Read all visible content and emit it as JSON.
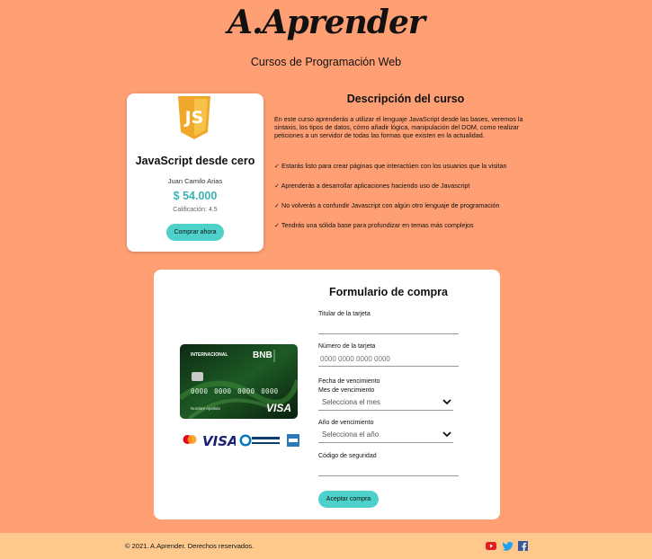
{
  "header": {
    "logo": "A.Aprender",
    "subtitle": "Cursos de Programación Web"
  },
  "course": {
    "badge_icon": "javascript-shield-icon",
    "title": "JavaScript desde cero",
    "author": "Juan Camilo Arias",
    "price": "$ 54.000",
    "rating": "Calificación: 4.5",
    "buy_label": "Comprar ahora"
  },
  "description": {
    "heading": "Descripción del curso",
    "body": "En este curso aprenderás a utilizar el lenguaje JavaScript desde las bases, veremos la sintaxis, los tipos de datos, cómo añadir lógica, manipulación del DOM, como realizar peticiones a un servidor de todas las formas que existen en la actualidad.",
    "points": [
      "✓ Estarás listo para crear páginas que interactúen con los usuarios que la visitan",
      "✓ Aprenderás a desarrollar aplicaciones haciendo uso de Javascript",
      "✓ No volverás a confundir Javascript con algún otro lenguaje de programación",
      "✓ Tendrás una sólida base para profundizar en temas más complejos"
    ]
  },
  "card_image": {
    "label": "INTERNACIONAL",
    "bank": "BNB",
    "number": "0000 0000 0000 0000",
    "holder": "Nombre Apellido",
    "network": "VISA"
  },
  "brands": [
    "mastercard-icon",
    "visa-icon",
    "diners-club-icon",
    "american-express-icon"
  ],
  "form": {
    "heading": "Formulario de compra",
    "holder_label": "Titular de la tarjeta",
    "holder_value": "",
    "number_label": "Número de la tarjeta",
    "number_placeholder": "0000 0000 0000 0000",
    "expiry_label": "Fecha de vencimiento",
    "month_label": "Mes de vencimiento",
    "month_selected": "Selecciona el mes",
    "year_label": "Año de vencimiento",
    "year_selected": "Selecciona el año",
    "cvv_label": "Código de seguridad",
    "cvv_value": "",
    "submit_label": "Aceptar compra"
  },
  "footer": {
    "copyright": "© 2021. A.Aprender. Derechos reservados.",
    "social": [
      "youtube-icon",
      "twitter-icon",
      "facebook-icon"
    ]
  },
  "colors": {
    "background": "#ff9f73",
    "footer": "#ffc98e",
    "accent": "#4fd1cb",
    "price": "#3bb3b3"
  }
}
